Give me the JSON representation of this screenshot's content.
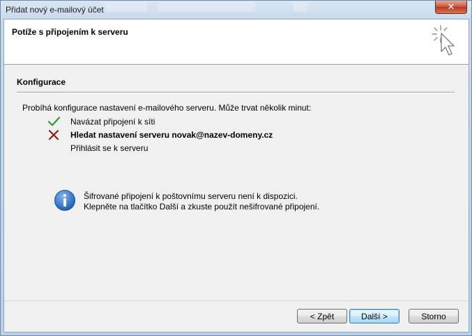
{
  "window": {
    "title": "Přidat nový e-mailový účet",
    "close_label": "✕"
  },
  "header": {
    "page_title": "Potíže s připojením k serveru",
    "icon": "wizard-cursor-icon"
  },
  "section": {
    "title": "Konfigurace",
    "intro": "Probíhá konfigurace nastavení e-mailového serveru. Může trvat několik minut:"
  },
  "steps": [
    {
      "label": "Navázat připojení k síti",
      "status": "done",
      "icon": "checkmark-icon"
    },
    {
      "label": "Hledat nastavení serveru novak@nazev-domeny.cz",
      "status": "failed",
      "icon": "cross-icon"
    },
    {
      "label": "Přihlásit se k serveru",
      "status": "pending",
      "icon": ""
    }
  ],
  "info": {
    "icon": "info-icon",
    "line1": "Šifrované připojení k poštovnímu serveru není k dispozici.",
    "line2": "Klepněte na tlačítko Další a zkuste použít nešifrované připojení."
  },
  "buttons": {
    "back": "< Zpět",
    "next": "Další >",
    "cancel": "Storno"
  },
  "colors": {
    "check": "#2e9a2e",
    "cross": "#8b1a1a",
    "info_blue": "#1f5fb4"
  }
}
